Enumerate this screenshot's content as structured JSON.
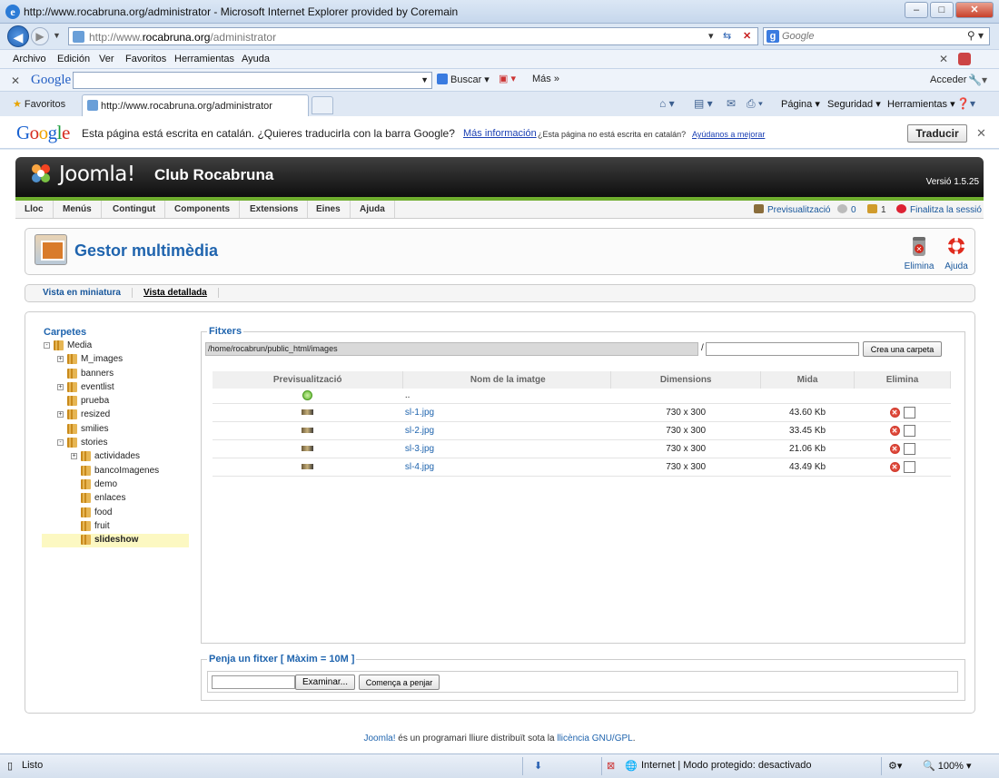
{
  "window": {
    "title": "http://www.rocabruna.org/administrator - Microsoft Internet Explorer provided by Coremain"
  },
  "address": {
    "url_prefix": "http://www.",
    "url_domain": "rocabruna.org",
    "url_suffix": "/administrator",
    "search_placeholder": "Google"
  },
  "menu": {
    "items": [
      "Archivo",
      "Edición",
      "Ver",
      "Favoritos",
      "Herramientas",
      "Ayuda"
    ]
  },
  "google_bar": {
    "logo": "Google",
    "buscar": "Buscar",
    "mas": "Más",
    "acceder": "Acceder"
  },
  "favorites": {
    "label": "Favoritos",
    "tab_title": "http://www.rocabruna.org/administrator",
    "pagina": "Página",
    "seguridad": "Seguridad",
    "herramientas": "Herramientas"
  },
  "translate": {
    "message": "Esta página está escrita en catalán. ¿Quieres traducirla con la barra Google?",
    "more_info": "Más información",
    "not_catalan": "¿Esta página no está escrita en catalán?",
    "help_improve": "Ayúdanos a mejorar",
    "button": "Traducir"
  },
  "joomla": {
    "brand": "Joomla!",
    "site_name": "Club Rocabruna",
    "version": "Versió 1.5.25",
    "menu": [
      "Lloc",
      "Menús",
      "Contingut",
      "Components",
      "Extensions",
      "Eines",
      "Ajuda"
    ],
    "preview": "Previsualització",
    "messages_count": "0",
    "users_count": "1",
    "logout": "Finalitza la sessió"
  },
  "toolbar": {
    "title": "Gestor multimèdia",
    "delete": "Elimina",
    "help": "Ajuda"
  },
  "subnav": {
    "thumbs": "Vista en miniatura",
    "details": "Vista detallada"
  },
  "folders": {
    "title": "Carpetes",
    "items": [
      {
        "label": "Media",
        "depth": 0,
        "toggle": "-"
      },
      {
        "label": "M_images",
        "depth": 1,
        "toggle": "+"
      },
      {
        "label": "banners",
        "depth": 1,
        "toggle": ""
      },
      {
        "label": "eventlist",
        "depth": 1,
        "toggle": "+"
      },
      {
        "label": "prueba",
        "depth": 1,
        "toggle": ""
      },
      {
        "label": "resized",
        "depth": 1,
        "toggle": "+"
      },
      {
        "label": "smilies",
        "depth": 1,
        "toggle": ""
      },
      {
        "label": "stories",
        "depth": 1,
        "toggle": "-"
      },
      {
        "label": "actividades",
        "depth": 2,
        "toggle": "+"
      },
      {
        "label": "bancoImagenes",
        "depth": 2,
        "toggle": ""
      },
      {
        "label": "demo",
        "depth": 2,
        "toggle": ""
      },
      {
        "label": "enlaces",
        "depth": 2,
        "toggle": ""
      },
      {
        "label": "food",
        "depth": 2,
        "toggle": ""
      },
      {
        "label": "fruit",
        "depth": 2,
        "toggle": ""
      },
      {
        "label": "slideshow",
        "depth": 2,
        "toggle": "",
        "selected": true
      }
    ]
  },
  "files": {
    "legend": "Fitxers",
    "path": "/home/rocabrun/public_html/images",
    "slash": "/",
    "create_folder": "Crea una carpeta",
    "headers": [
      "Previsualització",
      "Nom de la imatge",
      "Dimensions",
      "Mida",
      "Elimina"
    ],
    "up_label": "..",
    "rows": [
      {
        "name": "sl-1.jpg",
        "dims": "730 x 300",
        "size": "43.60 Kb"
      },
      {
        "name": "sl-2.jpg",
        "dims": "730 x 300",
        "size": "33.45 Kb"
      },
      {
        "name": "sl-3.jpg",
        "dims": "730 x 300",
        "size": "21.06 Kb"
      },
      {
        "name": "sl-4.jpg",
        "dims": "730 x 300",
        "size": "43.49 Kb"
      }
    ]
  },
  "upload": {
    "legend": "Penja un fitxer [ Màxim = 10M ]",
    "browse": "Examinar...",
    "start": "Comença a penjar"
  },
  "footer": {
    "joomla": "Joomla!",
    "text": " és un programari lliure distribuït sota la ",
    "license": "llicència GNU/GPL",
    "end": "."
  },
  "status": {
    "text": "Listo",
    "zone": "Internet | Modo protegido: desactivado",
    "zoom": "100%"
  }
}
